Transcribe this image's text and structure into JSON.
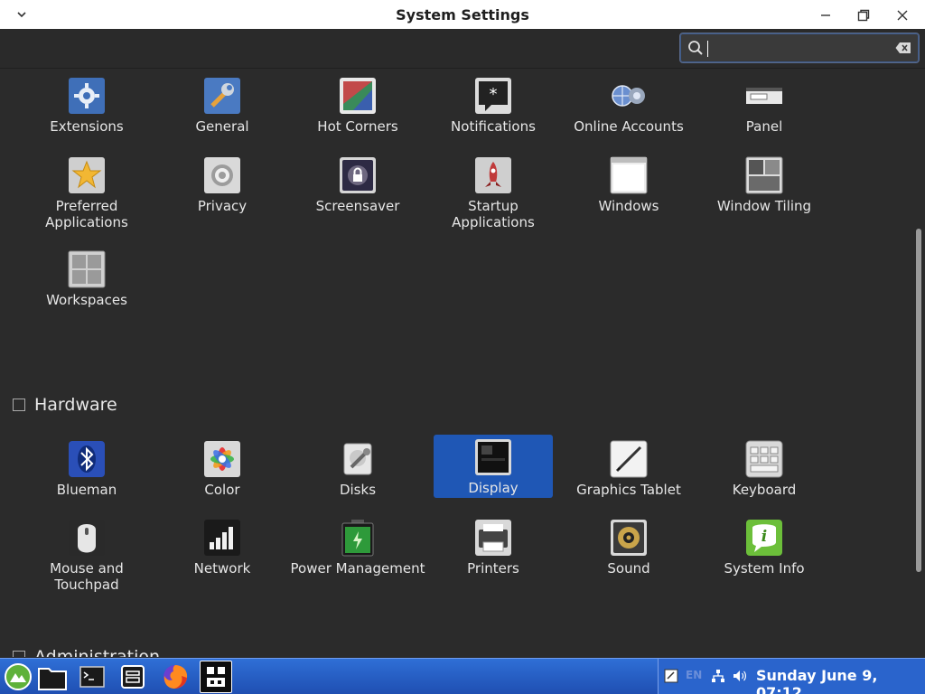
{
  "window": {
    "title": "System Settings"
  },
  "search": {
    "value": "",
    "placeholder": ""
  },
  "preferences_items": [
    {
      "label": "Extensions",
      "icon": "extensions-icon"
    },
    {
      "label": "General",
      "icon": "general-icon"
    },
    {
      "label": "Hot Corners",
      "icon": "hot-corners-icon"
    },
    {
      "label": "Notifications",
      "icon": "notifications-icon"
    },
    {
      "label": "Online Accounts",
      "icon": "online-accounts-icon"
    },
    {
      "label": "Panel",
      "icon": "panel-icon"
    },
    {
      "label": "Preferred Applications",
      "icon": "preferred-applications-icon"
    },
    {
      "label": "Privacy",
      "icon": "privacy-icon"
    },
    {
      "label": "Screensaver",
      "icon": "screensaver-icon"
    },
    {
      "label": "Startup Applications",
      "icon": "startup-applications-icon"
    },
    {
      "label": "Windows",
      "icon": "windows-icon"
    },
    {
      "label": "Window Tiling",
      "icon": "window-tiling-icon"
    },
    {
      "label": "Workspaces",
      "icon": "workspaces-icon"
    }
  ],
  "hardware": {
    "title": "Hardware",
    "items": [
      {
        "label": "Blueman",
        "icon": "bluetooth-icon"
      },
      {
        "label": "Color",
        "icon": "color-icon"
      },
      {
        "label": "Disks",
        "icon": "disks-icon"
      },
      {
        "label": "Display",
        "icon": "display-icon",
        "selected": true
      },
      {
        "label": "Graphics Tablet",
        "icon": "graphics-tablet-icon"
      },
      {
        "label": "Keyboard",
        "icon": "keyboard-icon"
      },
      {
        "label": "Mouse and Touchpad",
        "icon": "mouse-icon"
      },
      {
        "label": "Network",
        "icon": "network-icon"
      },
      {
        "label": "Power Management",
        "icon": "power-icon"
      },
      {
        "label": "Printers",
        "icon": "printer-icon"
      },
      {
        "label": "Sound",
        "icon": "sound-icon"
      },
      {
        "label": "System Info",
        "icon": "system-info-icon"
      }
    ]
  },
  "administration": {
    "title": "Administration"
  },
  "taskbar": {
    "lang": "EN",
    "clock": "Sunday June  9, 07:12"
  },
  "colors": {
    "selection": "#1f57b5",
    "taskbar": "#2a64cc",
    "background": "#2b2b2b"
  }
}
